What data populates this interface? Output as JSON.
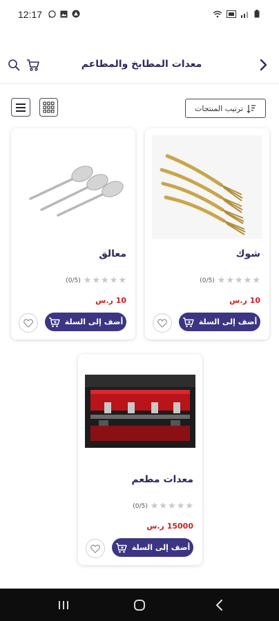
{
  "status_bar": {
    "time": "12:17",
    "left_icons": [
      "whatsapp-icon",
      "image-icon",
      "alert-icon"
    ],
    "right_icons": [
      "wifi-icon",
      "volte-icon",
      "signal-icon",
      "battery-icon"
    ]
  },
  "header": {
    "title": "معدات المطابخ والمطاعم",
    "back_icon": "chevron-right-icon",
    "cart_icon": "cart-icon",
    "search_icon": "search-icon"
  },
  "toolbar": {
    "sort_label": "ترتيب المنتجات",
    "sort_icon": "sort-icon",
    "grid_icon": "grid-view-icon",
    "list_icon": "list-view-icon"
  },
  "products": [
    {
      "name": "شوك",
      "rating_text": "(0/5)",
      "rating": 0,
      "max_rating": 5,
      "price": "10 ر.س",
      "add_label": "أضف إلى السلة",
      "image": "golden-forks-image"
    },
    {
      "name": "معالق",
      "rating_text": "(0/5)",
      "rating": 0,
      "max_rating": 5,
      "price": "10 ر.س",
      "add_label": "أضف إلى السلة",
      "image": "silver-spoons-image"
    },
    {
      "name": "معدات مطعم",
      "rating_text": "(0/5)",
      "rating": 0,
      "max_rating": 5,
      "price": "15000 ر.س",
      "add_label": "أضف إلى السلة",
      "image": "espresso-machine-image"
    }
  ],
  "colors": {
    "accent": "#3c3583",
    "title": "#2e2a5c",
    "price": "#d01e1e",
    "star_empty": "#c8c8c8",
    "navbar": "#0d0d0d"
  },
  "nav_bar": {
    "icons": [
      "recent-apps-icon",
      "home-icon",
      "back-icon"
    ]
  }
}
